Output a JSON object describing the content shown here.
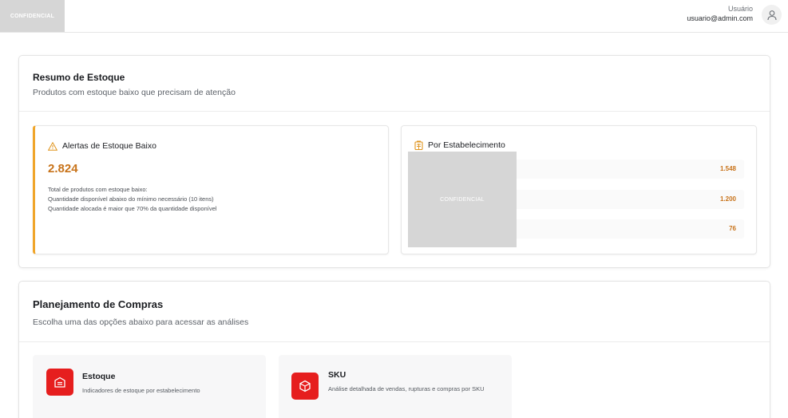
{
  "header": {
    "logo_text": "CONFIDENCIAL",
    "user_name": "Usuário",
    "user_email": "usuario@admin.com",
    "avatar_icon": "user-icon"
  },
  "resumo": {
    "title": "Resumo de Estoque",
    "subtitle": "Produtos com estoque baixo que precisam de atenção",
    "alertas": {
      "icon": "warning-triangle-icon",
      "title": "Alertas de Estoque Baixo",
      "count": "2.824",
      "lines": [
        "Total de produtos com estoque baixo:",
        "Quantidade disponível abaixo do mínimo necessário (10 itens)",
        "Quantidade alocada é maior que 70% da quantidade disponível"
      ]
    },
    "estabelecimento": {
      "icon": "building-icon",
      "title": "Por Estabelecimento",
      "redacted_text": "CONFIDENCIAL",
      "values": [
        "1.548",
        "1.200",
        "76"
      ]
    }
  },
  "planejamento": {
    "title": "Planejamento de Compras",
    "subtitle": "Escolha uma das opções abaixo para acessar as análises",
    "options": [
      {
        "icon": "warehouse-icon",
        "name": "Estoque",
        "desc": "Indicadores de estoque por estabelecimento"
      },
      {
        "icon": "package-icon",
        "name": "SKU",
        "desc": "Análise detalhada de vendas, rupturas e compras por SKU"
      }
    ]
  },
  "colors": {
    "accent_orange": "#c8731a",
    "alert_border": "#f0a52a",
    "icon_red": "#e61e1e"
  }
}
